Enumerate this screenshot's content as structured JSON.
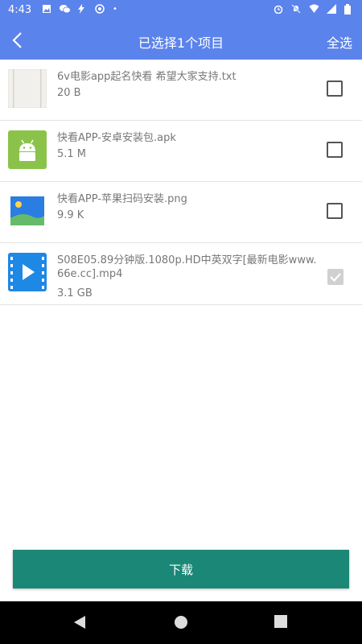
{
  "status": {
    "time": "4:43"
  },
  "header": {
    "title": "已选择1个项目",
    "select_all": "全选"
  },
  "files": [
    {
      "name": "6v电影app起名快看 希望大家支持.txt",
      "size": "20 B",
      "type": "txt",
      "checked": false
    },
    {
      "name": "快看APP-安卓安装包.apk",
      "size": "5.1 M",
      "type": "apk",
      "checked": false
    },
    {
      "name": "快看APP-苹果扫码安装.png",
      "size": "9.9 K",
      "type": "png",
      "checked": false
    },
    {
      "name": "S08E05.89分钟版.1080p.HD中英双字[最新电影www.66e.cc].mp4",
      "size": "3.1 GB",
      "type": "mp4",
      "checked": true,
      "disabled": true
    }
  ],
  "footer": {
    "download_label": "下载"
  },
  "colors": {
    "primary": "#5b83ec",
    "accent": "#1a8777"
  }
}
